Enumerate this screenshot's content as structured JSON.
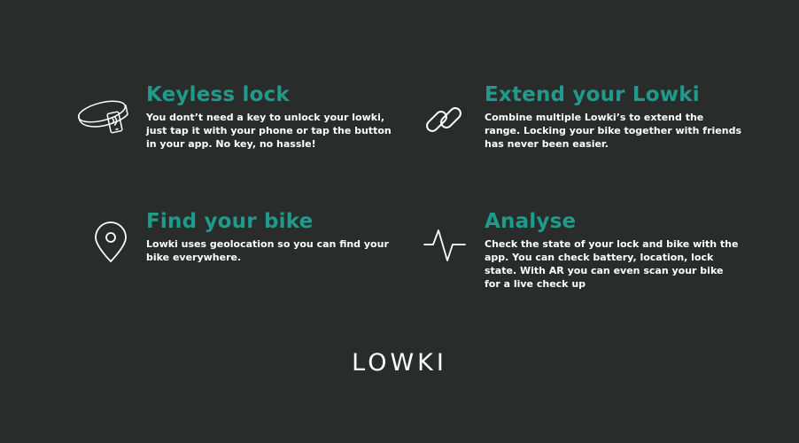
{
  "features": [
    {
      "title": "Keyless lock",
      "description": "You dont’t need a key to unlock your lowki, just tap it with your phone or tap the button in your app. No key, no hassle!",
      "icon": "bracelet-lock-icon"
    },
    {
      "title": "Extend your Lowki",
      "description": "Combine multiple Lowki’s to extend the range. Locking your bike together with friends has never been easier.",
      "icon": "chain-link-icon"
    },
    {
      "title": "Find your bike",
      "description": "Lowki uses geolocation so you can find your bike everywhere.",
      "icon": "location-pin-icon"
    },
    {
      "title": "Analyse",
      "description": "Check the state of your lock and bike with the app. You can check battery, location, lock state. With AR you can even scan your bike for a live check up",
      "icon": "pulse-icon"
    }
  ],
  "brand": {
    "logo_text": "LOWKI"
  },
  "colors": {
    "background": "#2a2c2c",
    "accent": "#1f9b8b",
    "text": "#ffffff"
  }
}
